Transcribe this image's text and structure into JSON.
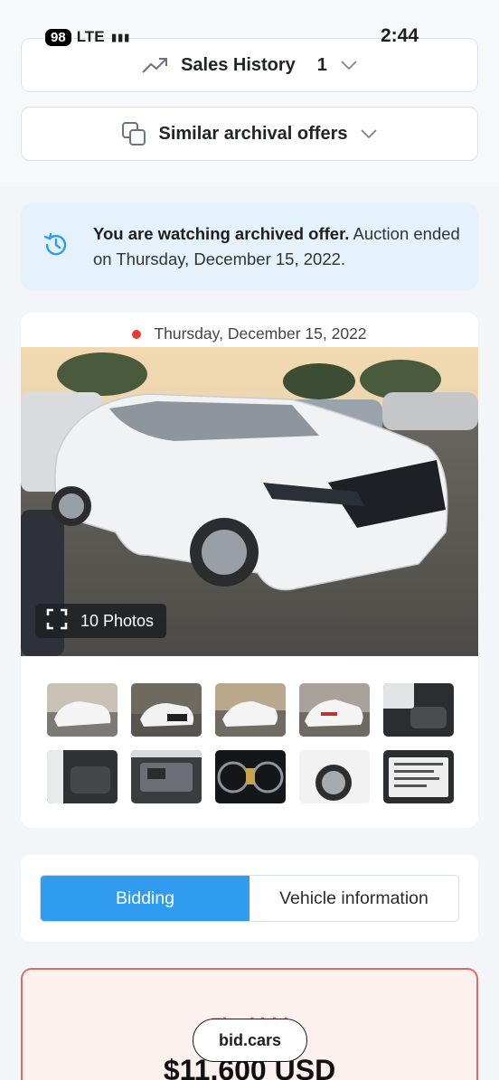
{
  "status_bar": {
    "battery": "98",
    "network": "LTE",
    "time": "2:44"
  },
  "sales_history": {
    "label": "Sales History",
    "count": "1"
  },
  "similar_offers": {
    "label": "Similar archival offers"
  },
  "notice": {
    "bold": "You are watching archived offer.",
    "text": " Auction ended on Thursday, December 15, 2022."
  },
  "photos": {
    "date": "Thursday, December 15, 2022",
    "badge_label": "10 Photos",
    "thumbnails": [
      "front-side",
      "front",
      "rear-side",
      "rear",
      "interior-front",
      "interior-rear",
      "engine",
      "dashboard",
      "wheel",
      "label-sticker"
    ]
  },
  "tabs": {
    "bidding": "Bidding",
    "vehicle_info": "Vehicle information",
    "active": "bidding"
  },
  "bid": {
    "label": "Final bid",
    "price": "$11,600 USD"
  },
  "brand": {
    "name": "bid.cars"
  },
  "colors": {
    "accent": "#2f9cf0",
    "notice_bg": "#e5f1fb",
    "alert": "#e53935"
  }
}
